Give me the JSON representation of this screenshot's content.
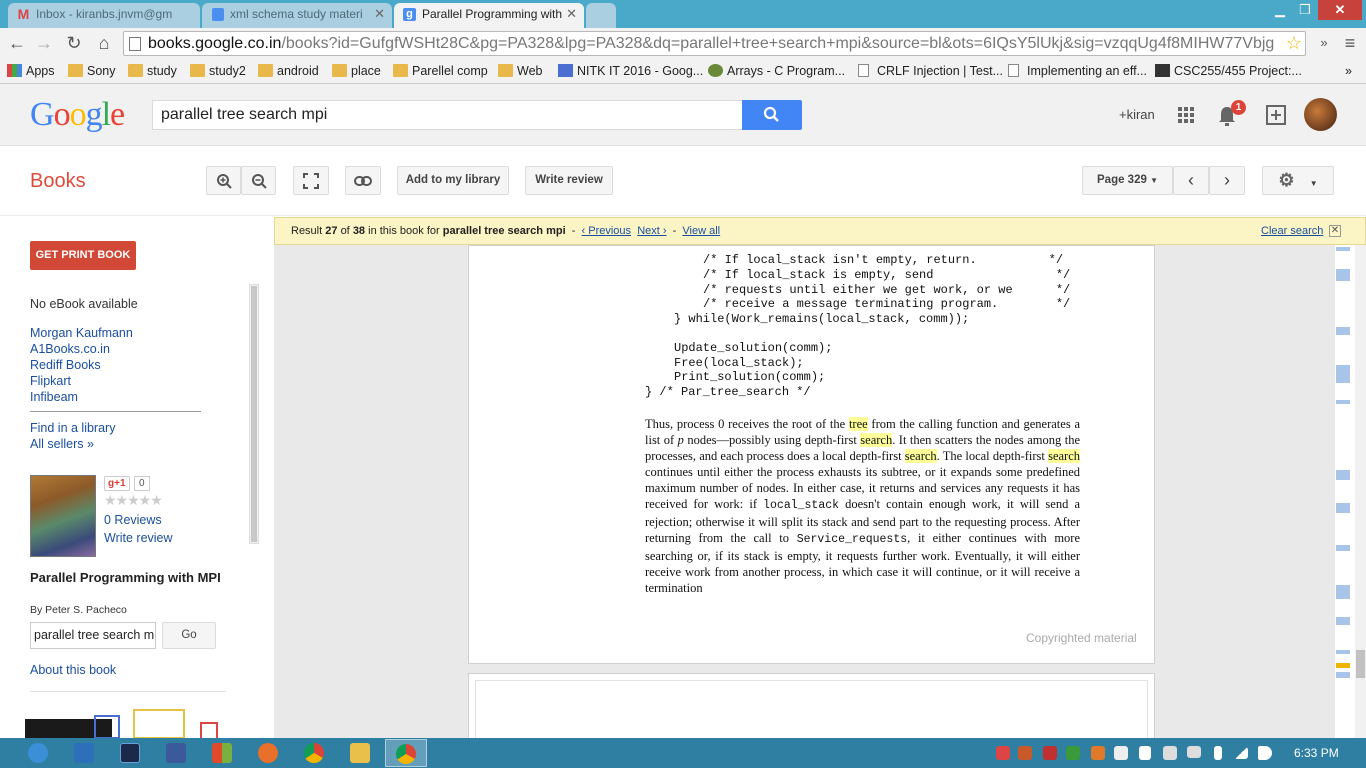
{
  "browser": {
    "tabs": [
      {
        "title": "Inbox - kiranbs.jnvm@gm",
        "icon": "gmail-icon"
      },
      {
        "title": "xml schema study materi",
        "icon": "docs-icon"
      },
      {
        "title": "Parallel Programming with",
        "icon": "google-icon"
      }
    ],
    "url_host": "books.google.co.in",
    "url_path": "/books?id=GufgfWSHt28C&pg=PA328&lpg=PA328&dq=parallel+tree+search+mpi&source=bl&ots=6IQsY5lUkj&sig=vzqqUg4f8MIHW77Vbjg",
    "bookmarks": [
      "Apps",
      "Sony",
      "study",
      "study2",
      "android",
      "place",
      "Parellel comp",
      "Web",
      "NITK IT 2016 - Goog...",
      "Arrays - C Program...",
      "CRLF Injection | Test...",
      "Implementing an eff...",
      "CSC255/455 Project:..."
    ]
  },
  "google": {
    "logo": "Google",
    "query": "parallel tree search mpi",
    "user": "+kiran",
    "notifications": "1"
  },
  "books": {
    "title": "Books",
    "add_library": "Add to my library",
    "write_review": "Write review",
    "page_label": "Page 329"
  },
  "result": {
    "prefix": "Result",
    "current": "27",
    "of": "of",
    "total": "38",
    "mid": "in this book for",
    "query": "parallel tree search mpi",
    "previous": "‹ Previous",
    "next": "Next ›",
    "view_all": "View all",
    "clear": "Clear search"
  },
  "sidebar": {
    "get_print": "GET PRINT BOOK",
    "no_ebook": "No eBook available",
    "sellers": [
      "Morgan Kaufmann",
      "A1Books.co.in",
      "Rediff Books",
      "Flipkart",
      "Infibeam"
    ],
    "find_library": "Find in a library",
    "all_sellers": "All sellers »",
    "gplus": "g+1",
    "gplus_count": "0",
    "reviews": "0 Reviews",
    "write_review": "Write review",
    "book_title": "Parallel Programming with MPI",
    "author": "By Peter S. Pacheco",
    "search_value": "parallel tree search m",
    "go": "Go",
    "about": "About this book"
  },
  "page": {
    "code_lines": [
      "/* If local_stack isn't empty, return.          */",
      "/* If local_stack is empty, send                 */",
      "/* requests until either we get work, or we      */",
      "/* receive a message terminating program.        */",
      "} while(Work_remains(local_stack, comm));",
      "Update_solution(comm);",
      "Free(local_stack);",
      "Print_solution(comm);",
      "} /* Par_tree_search */"
    ],
    "p1": "Thus, process 0 receives the root of the ",
    "hl_tree": "tree",
    "p2": " from the calling function and generates a list of ",
    "p_var": "p",
    "p3": " nodes—possibly using depth-first ",
    "hl_search1": "search",
    "p4": ". It then scatters the nodes among the processes, and each process does a local depth-first ",
    "hl_search2": "search",
    "p5": ". The local depth-first ",
    "hl_search3": "search",
    "p6": " continues until either the process exhausts its subtree, or it expands some predefined maximum number of nodes. In either case, it returns and services any requests it has received for work: if ",
    "code1": "local_stack",
    "p7": " doesn't contain enough work, it will send a rejection; otherwise it will split its stack and send part to the requesting process. After returning from the call to ",
    "code2": "Service_requests",
    "p8": ", it either continues with more searching or, if its stack is empty, it requests further work. Eventually, it will either receive work from another process, in which case it will continue, or it will receive a termination",
    "copyright": "Copyrighted material"
  },
  "taskbar": {
    "time": "6:33 PM"
  }
}
